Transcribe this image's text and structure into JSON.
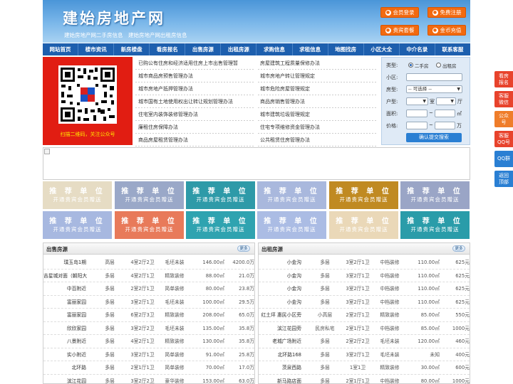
{
  "site": {
    "logo": "建始房地产网",
    "tagline": "建始房地产网二手房信息　建始房地产网出租房信息"
  },
  "header_buttons": [
    {
      "label": "会员登录",
      "icon": "user-icon"
    },
    {
      "label": "免费注册",
      "icon": "register-icon"
    },
    {
      "label": "贵宾套餐",
      "icon": "vip-icon"
    },
    {
      "label": "金币充值",
      "icon": "coin-icon"
    }
  ],
  "nav": [
    "网站首页",
    "楼市资讯",
    "新房楼盘",
    "看房报名",
    "出售房源",
    "出租房源",
    "求购信息",
    "求租信息",
    "地图找房",
    "小区大全",
    "中介名录",
    "联系客服"
  ],
  "qr": {
    "caption": "扫描二维码，关注公众号"
  },
  "links": {
    "left": [
      "已购公有住房和经济适用住房上市出售管理暂",
      "城市商品房预售管理办法",
      "城市房地产抵押管理办法",
      "城市国有土地使用权出让转让规划管理办法",
      "住宅室内装饰装修管理办法",
      "廉租住房保障办法",
      "商品房屋租赁管理办法"
    ],
    "right": [
      "房屋建筑工程质量保修办法",
      "城市房地产转让管理规定",
      "城市危险房屋管理规定",
      "商品房销售管理办法",
      "城市建筑垃圾管理规定",
      "住宅专项维修资金管理办法",
      "公共租赁住房管理办法"
    ]
  },
  "search": {
    "type_label": "类型:",
    "type_options": [
      "二手房",
      "出租房"
    ],
    "community_label": "小区:",
    "housetype_label": "房型:",
    "housetype_value": "-- 可选择 --",
    "layout_label": "户型:",
    "room_unit": "室",
    "hall_unit": "厅",
    "area_label": "面积:",
    "area_unit": "㎡",
    "price_label": "价格:",
    "price_unit": "万",
    "range_sep": "~",
    "submit": "确认提交搜索"
  },
  "ads": {
    "title": "推 荐 单 位",
    "subtitle": "开通贵宾会员赠送",
    "colors": [
      "#e6dcc4",
      "#9aa8c8",
      "#2e9aa8",
      "#a9b8dd",
      "#c08a22",
      "#9aa5c6",
      "#a7b8e0",
      "#e87a5a",
      "#2fa3b0",
      "#abbce4",
      "#ead8b8",
      "#2a9ca9"
    ]
  },
  "sale": {
    "title": "出售房源",
    "more": "更多",
    "rows": [
      [
        "璞玉岛1期",
        "高层",
        "4室2厅2卫",
        "毛坯未装",
        "146.00㎡",
        "4200.0万"
      ],
      [
        "吉星城对面（朝阳大",
        "多层",
        "4室2厅1卫",
        "精致装修",
        "88.00㎡",
        "21.0万"
      ],
      [
        "中百附近",
        "多层",
        "2室2厅1卫",
        "简单装修",
        "80.00㎡",
        "23.8万"
      ],
      [
        "富丽家园",
        "多层",
        "3室2厅1卫",
        "毛坯未装",
        "100.00㎡",
        "29.5万"
      ],
      [
        "富丽家园",
        "多层",
        "6室2厅3卫",
        "精致装修",
        "208.00㎡",
        "65.0万"
      ],
      [
        "欣欣家园",
        "多层",
        "3室2厅2卫",
        "毛坯未装",
        "135.00㎡",
        "35.8万"
      ],
      [
        "八景附近",
        "多层",
        "4室2厅1卫",
        "精致装修",
        "130.00㎡",
        "35.8万"
      ],
      [
        "实小附近",
        "多层",
        "3室2厅1卫",
        "简单装修",
        "91.00㎡",
        "25.8万"
      ],
      [
        "北环路",
        "多层",
        "2室1厅1卫",
        "简单装修",
        "70.00㎡",
        "17.0万"
      ],
      [
        "滨江花园",
        "多层",
        "3室2厅2卫",
        "豪华装修",
        "153.00㎡",
        "63.0万"
      ]
    ]
  },
  "rent": {
    "title": "出租房源",
    "more": "更多",
    "rows": [
      [
        "小金沟",
        "多层",
        "3室2厅1卫",
        "中档装修",
        "110.00㎡",
        "625元"
      ],
      [
        "小金沟",
        "多层",
        "3室2厅1卫",
        "中档装修",
        "110.00㎡",
        "625元"
      ],
      [
        "小金沟",
        "多层",
        "3室2厅1卫",
        "中档装修",
        "110.00㎡",
        "625元"
      ],
      [
        "小金沟",
        "多层",
        "3室2厅1卫",
        "中档装修",
        "110.00㎡",
        "625元"
      ],
      [
        "红土坪 惠民小区旁",
        "小高层",
        "2室2厅1卫",
        "精致装修",
        "85.00㎡",
        "550元"
      ],
      [
        "滨江花园旁",
        "民房私宅",
        "2室1厅1卫",
        "中档装修",
        "85.00㎡",
        "1000元"
      ],
      [
        "老城广场附近",
        "多层",
        "2室2厅2卫",
        "毛坯未装",
        "120.00㎡",
        "460元"
      ],
      [
        "北环路168",
        "多层",
        "3室2厅1卫",
        "毛坯未装",
        "未知",
        "400元"
      ],
      [
        "茨泉西路",
        "多层",
        "1室1卫",
        "精致装修",
        "30.00㎡",
        "600元"
      ],
      [
        "新马路店面",
        "多层",
        "2室1厅1卫",
        "中档装修",
        "80.00㎡",
        "1000元"
      ]
    ]
  },
  "float_tabs": [
    "看房报名",
    "客服微信",
    "公众号",
    "客服QQ号",
    "QQ群",
    "返回顶部"
  ]
}
